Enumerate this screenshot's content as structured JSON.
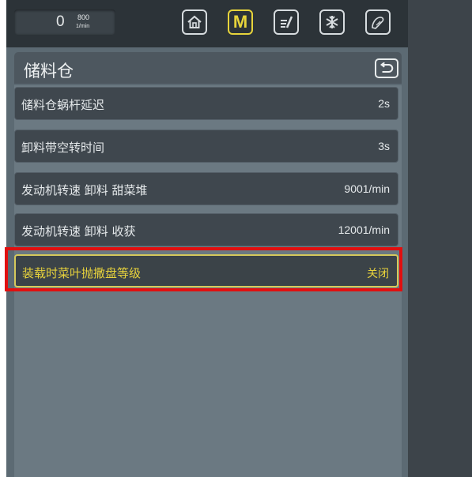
{
  "colors": {
    "accent": "#e7d43b",
    "highlight": "#e10f0f",
    "panel": "#5c6a73",
    "topbar": "#2c3338"
  },
  "topbar": {
    "rpm_value": "0",
    "rpm_target": "800",
    "rpm_unit": "1/min",
    "buttons": [
      {
        "icon": "home-icon"
      },
      {
        "icon": "manual-mode-icon",
        "label": "M",
        "active": true
      },
      {
        "icon": "settings-list-icon"
      },
      {
        "icon": "snowflake-icon"
      },
      {
        "icon": "hand-icon"
      }
    ]
  },
  "panel": {
    "title": "储料仓",
    "back_icon": "back-icon"
  },
  "rows": [
    {
      "label": "储料仓蜗杆延迟",
      "value": "2s"
    },
    {
      "label": "卸料带空转时间",
      "value": "3s"
    },
    {
      "label": "发动机转速 卸料 甜菜堆",
      "value": "9001/min"
    },
    {
      "label": "发动机转速 卸料 收获",
      "value": "12001/min"
    },
    {
      "label": "装载时菜叶抛撒盘等级",
      "value": "关闭",
      "selected": true
    }
  ]
}
